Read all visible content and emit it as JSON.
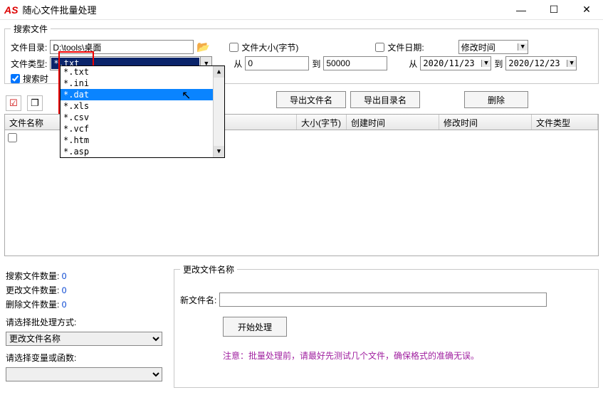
{
  "window": {
    "logo": "AS",
    "title": "随心文件批量处理"
  },
  "search": {
    "legend": "搜索文件",
    "dir_label": "文件目录:",
    "dir_value": "D:\\tools\\桌面",
    "type_label": "文件类型:",
    "type_selected": "*.txt",
    "type_options": [
      "*.txt",
      "*.ini",
      "*.dat",
      "*.xls",
      "*.csv",
      "*.vcf",
      "*.htm",
      "*.asp"
    ],
    "type_highlight_index": 2,
    "include_time_label": "搜索时",
    "size_check_label": "文件大小(字节)",
    "from_label": "从",
    "to_label": "到",
    "size_from": "0",
    "size_to": "50000",
    "date_check_label": "文件日期:",
    "date_from": "2020/11/23",
    "date_to": "2020/12/23",
    "date_type_selected": "修改时间"
  },
  "toolbar": {
    "export_filename": "导出文件名",
    "export_dirname": "导出目录名",
    "delete": "删除"
  },
  "table": {
    "columns": [
      "文件名称",
      "大小(字节)",
      "创建时间",
      "修改时间",
      "文件类型"
    ]
  },
  "stats": {
    "search_count_label": "搜索文件数量:",
    "search_count": "0",
    "change_count_label": "更改文件数量:",
    "change_count": "0",
    "delete_count_label": "删除文件数量:",
    "delete_count": "0",
    "method_label": "请选择批处理方式:",
    "method_selected": "更改文件名称",
    "var_label": "请选择变量或函数:"
  },
  "rename": {
    "legend": "更改文件名称",
    "new_name_label": "新文件名:",
    "new_name_value": "",
    "start_btn": "开始处理",
    "note": "注意：批量处理前，请最好先测试几个文件，确保格式的准确无误。"
  }
}
